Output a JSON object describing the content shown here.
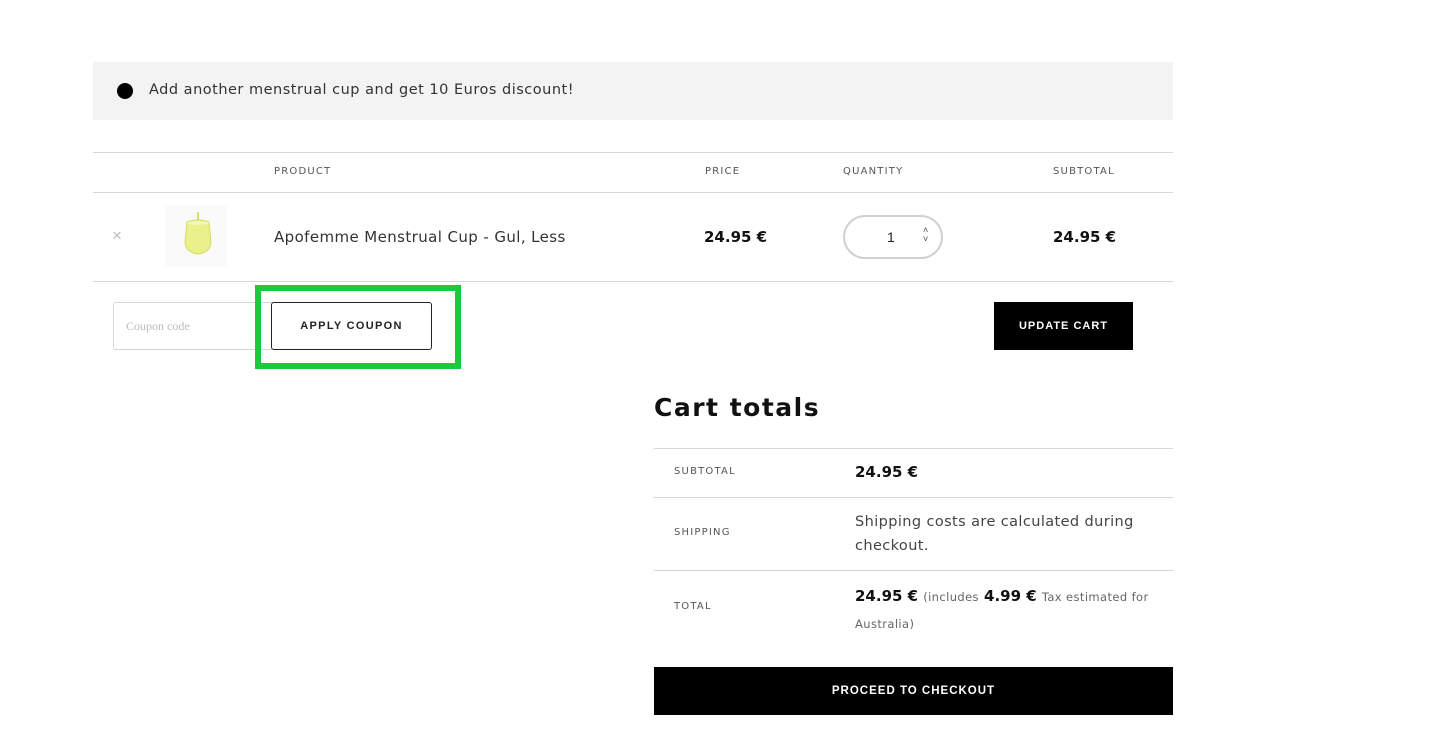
{
  "notice": {
    "text": "Add another menstrual cup and get 10 Euros discount!"
  },
  "table": {
    "headers": {
      "product": "PRODUCT",
      "price": "PRICE",
      "quantity": "QUANTITY",
      "subtotal": "SUBTOTAL"
    },
    "rows": [
      {
        "remove": "×",
        "product": "Apofemme Menstrual Cup - Gul, Less",
        "price": "24.95 €",
        "quantity": "1",
        "subtotal": "24.95 €",
        "thumb_color": "#eaf08a"
      }
    ]
  },
  "coupon": {
    "placeholder": "Coupon code",
    "apply_label": "APPLY COUPON",
    "highlight_color": "#1ccb3c"
  },
  "update_cart_label": "UPDATE CART",
  "totals": {
    "title": "Cart totals",
    "subtotal_label": "SUBTOTAL",
    "subtotal_value": "24.95 €",
    "shipping_label": "SHIPPING",
    "shipping_value": "Shipping costs are calculated during checkout.",
    "total_label": "TOTAL",
    "total_value": "24.95 €",
    "total_includes_prefix": "(includes",
    "tax_value": "4.99 €",
    "tax_suffix": "Tax estimated for Australia)"
  },
  "checkout_label": "PROCEED TO CHECKOUT"
}
